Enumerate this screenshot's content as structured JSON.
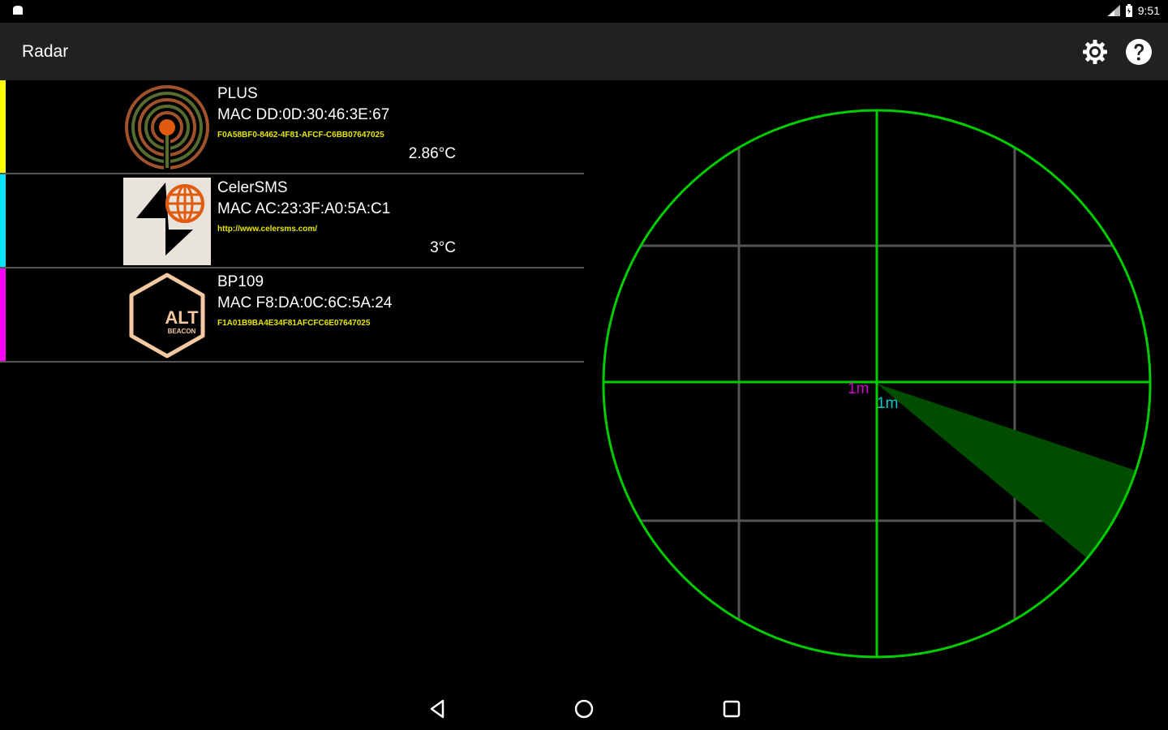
{
  "status_bar": {
    "time": "9:51"
  },
  "app_bar": {
    "title": "Radar"
  },
  "devices": [
    {
      "name": "PLUS",
      "mac": "MAC DD:0D:30:46:3E:67",
      "uuid": "F0A58BF0-8462-4F81-AFCF-C6BB07647025",
      "temperature": "2.86°C",
      "stripe_color": "#ffff00",
      "icon": "radio-signal-icon"
    },
    {
      "name": "CelerSMS",
      "mac": "MAC AC:23:3F:A0:5A:C1",
      "uuid": "http://www.celersms.com/",
      "temperature": "3°C",
      "stripe_color": "#00e5ff",
      "icon": "celersms-globe-icon"
    },
    {
      "name": "BP109",
      "mac": "MAC F8:DA:0C:6C:5A:24",
      "uuid": "F1A01B9BA4E34F81AFCFC6E07647025",
      "temperature": "",
      "stripe_color": "#ff00ff",
      "icon": "alt-beacon-icon"
    }
  ],
  "radar": {
    "label_magenta": "1m",
    "label_cyan": "1m",
    "ring_color": "#00cc00",
    "grid_color": "#555555",
    "sweep_color": "#004d00"
  }
}
